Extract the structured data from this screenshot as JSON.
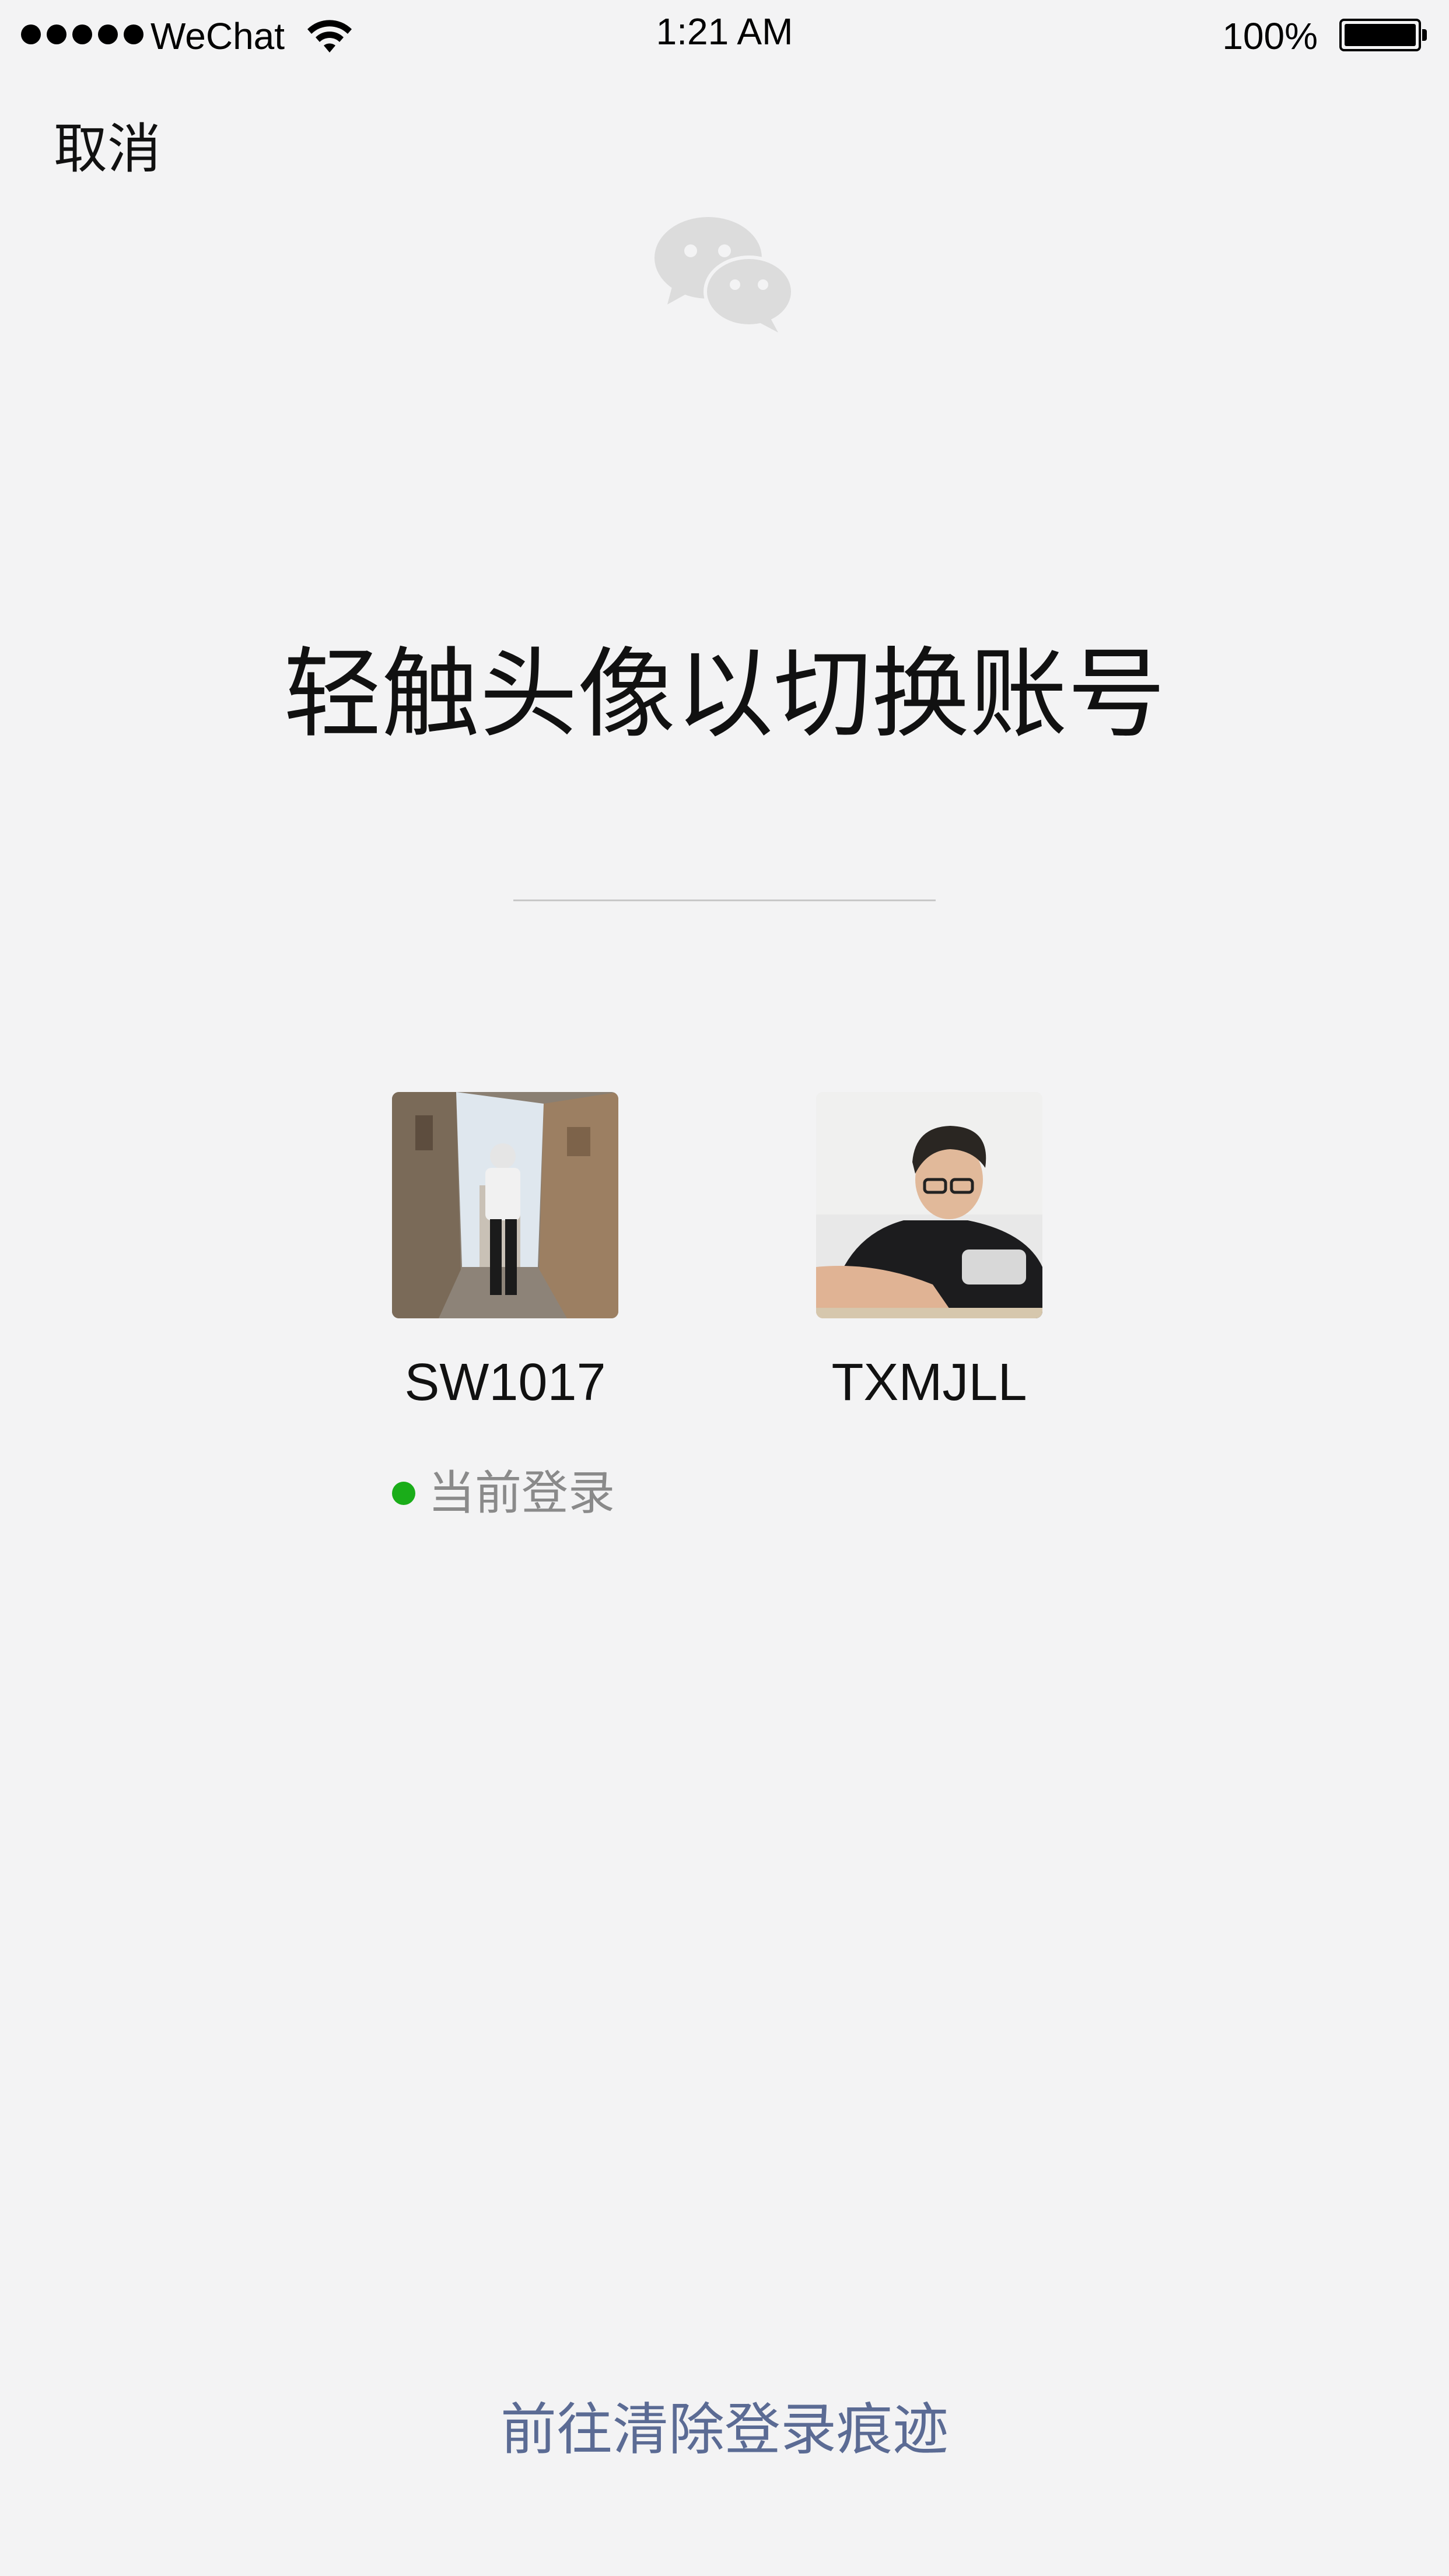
{
  "status_bar": {
    "carrier": "WeChat",
    "time": "1:21 AM",
    "battery": "100%",
    "signal_icon": "signal-dots-icon",
    "wifi_icon": "wifi-icon",
    "battery_icon": "battery-icon"
  },
  "nav": {
    "cancel_label": "取消"
  },
  "logo_icon": "wechat-logo-icon",
  "title": "轻触头像以切换账号",
  "accounts": [
    {
      "name": "SW1017"
    },
    {
      "name": "TXMJLL"
    }
  ],
  "current_login": {
    "label": "当前登录",
    "indicator_color": "#1aad19"
  },
  "clear_link": "前往清除登录痕迹",
  "colors": {
    "background": "#f3f3f4",
    "link": "#5b6b94",
    "logo": "#dcdcdc"
  }
}
